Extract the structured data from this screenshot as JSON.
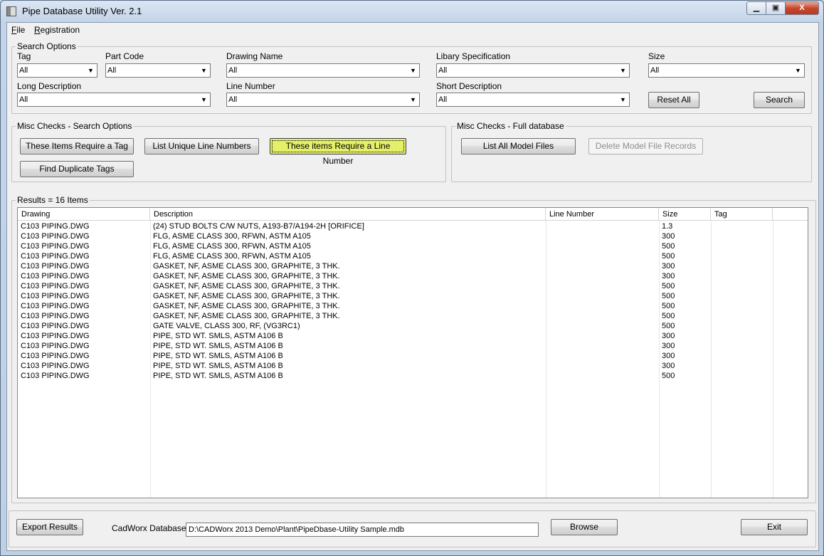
{
  "window": {
    "title": "Pipe Database Utility Ver. 2.1",
    "min_glyph": "▁",
    "max_glyph": "▣",
    "close_glyph": "X"
  },
  "menu": {
    "file": {
      "mnemonic": "F",
      "rest": "ile"
    },
    "registration": {
      "mnemonic": "R",
      "rest": "egistration"
    }
  },
  "search": {
    "title": "Search Options",
    "tag": {
      "label": "Tag",
      "value": "All"
    },
    "part_code": {
      "label": "Part Code",
      "value": "All"
    },
    "drawing_name": {
      "label": "Drawing Name",
      "value": "All"
    },
    "libary_spec": {
      "label": "Libary Specification",
      "value": "All"
    },
    "size": {
      "label": "Size",
      "value": "All"
    },
    "long_description": {
      "label": "Long Description",
      "value": "All"
    },
    "line_number": {
      "label": "Line Number",
      "value": "All"
    },
    "short_description": {
      "label": "Short Description",
      "value": "All"
    },
    "reset_all": "Reset All",
    "search_btn": "Search",
    "arrow_glyph": "▼"
  },
  "misc_search": {
    "title": "Misc Checks - Search Options",
    "require_tag": "These Items Require a Tag",
    "unique_lines": "List Unique Line Numbers",
    "require_line": "These items Require a Line Number",
    "duplicate_tags": "Find Duplicate Tags",
    "highlight_color": "#e4f06a"
  },
  "misc_full": {
    "title": "Misc Checks - Full database",
    "list_model_files": "List All Model Files",
    "delete_records": "Delete Model File Records"
  },
  "results": {
    "title": "Results = 16 Items",
    "columns": [
      "Drawing",
      "Description",
      "Line Number",
      "Size",
      "Tag"
    ],
    "rows": [
      [
        "C103 PIPING.DWG",
        "(24) STUD BOLTS C/W NUTS, A193-B7/A194-2H [ORIFICE]",
        "",
        "1.3",
        ""
      ],
      [
        "C103 PIPING.DWG",
        "FLG, ASME CLASS 300, RFWN, ASTM A105",
        "",
        "300",
        ""
      ],
      [
        "C103 PIPING.DWG",
        "FLG, ASME CLASS 300, RFWN, ASTM A105",
        "",
        "500",
        ""
      ],
      [
        "C103 PIPING.DWG",
        "FLG, ASME CLASS 300, RFWN, ASTM A105",
        "",
        "500",
        ""
      ],
      [
        "C103 PIPING.DWG",
        "GASKET, NF, ASME CLASS 300, GRAPHITE, 3 THK.",
        "",
        "300",
        ""
      ],
      [
        "C103 PIPING.DWG",
        "GASKET, NF, ASME CLASS 300, GRAPHITE, 3 THK.",
        "",
        "300",
        ""
      ],
      [
        "C103 PIPING.DWG",
        "GASKET, NF, ASME CLASS 300, GRAPHITE, 3 THK.",
        "",
        "500",
        ""
      ],
      [
        "C103 PIPING.DWG",
        "GASKET, NF, ASME CLASS 300, GRAPHITE, 3 THK.",
        "",
        "500",
        ""
      ],
      [
        "C103 PIPING.DWG",
        "GASKET, NF, ASME CLASS 300, GRAPHITE, 3 THK.",
        "",
        "500",
        ""
      ],
      [
        "C103 PIPING.DWG",
        "GASKET, NF, ASME CLASS 300, GRAPHITE, 3 THK.",
        "",
        "500",
        ""
      ],
      [
        "C103 PIPING.DWG",
        "GATE VALVE, CLASS 300, RF, (VG3RC1)",
        "",
        "500",
        ""
      ],
      [
        "C103 PIPING.DWG",
        "PIPE, STD WT. SMLS, ASTM A106 B",
        "",
        "300",
        ""
      ],
      [
        "C103 PIPING.DWG",
        "PIPE, STD WT. SMLS, ASTM A106 B",
        "",
        "300",
        ""
      ],
      [
        "C103 PIPING.DWG",
        "PIPE, STD WT. SMLS, ASTM A106 B",
        "",
        "300",
        ""
      ],
      [
        "C103 PIPING.DWG",
        "PIPE, STD WT. SMLS, ASTM A106 B",
        "",
        "300",
        ""
      ],
      [
        "C103 PIPING.DWG",
        "PIPE, STD WT. SMLS, ASTM A106 B",
        "",
        "500",
        ""
      ]
    ]
  },
  "footer": {
    "export": "Export Results",
    "db_label": "CadWorx Database:",
    "db_path": "D:\\CADWorx 2013 Demo\\Plant\\PipeDbase-Utility Sample.mdb",
    "browse": "Browse",
    "exit": "Exit"
  }
}
